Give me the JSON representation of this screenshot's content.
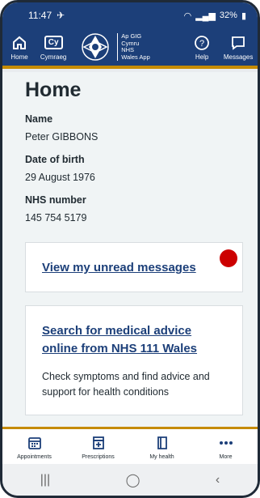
{
  "status": {
    "time": "11:47",
    "battery": "32%"
  },
  "appbar": {
    "home": "Home",
    "language": "Cymraeg",
    "language_icon_text": "Cy",
    "brand_lines": [
      "Ap GIG",
      "Cymru",
      "NHS",
      "Wales App"
    ],
    "help": "Help",
    "messages": "Messages"
  },
  "page": {
    "title": "Home",
    "name_label": "Name",
    "name_value": "Peter GIBBONS",
    "dob_label": "Date of birth",
    "dob_value": "29 August 1976",
    "nhs_label": "NHS number",
    "nhs_value": "145 754 5179"
  },
  "cards": {
    "unread_link": "View my unread messages",
    "advice_link": "Search for medical advice online from NHS 111 Wales",
    "advice_desc": "Check symptoms and find advice and support for health conditions"
  },
  "bottomnav": {
    "appointments": "Appointments",
    "prescriptions": "Prescriptions",
    "myhealth": "My health",
    "more": "More"
  },
  "colors": {
    "brand": "#1c3f79",
    "accent": "#c58b00",
    "alert": "#cc0000"
  }
}
